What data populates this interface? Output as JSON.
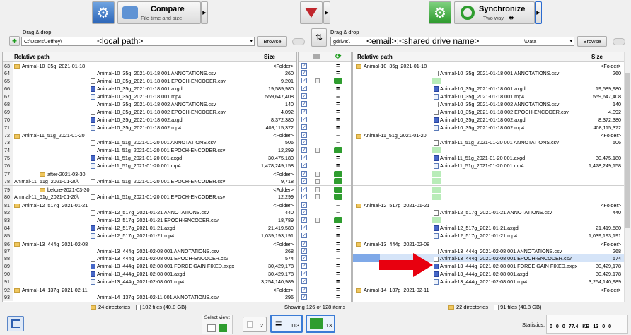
{
  "toolbar": {
    "compare_title": "Compare",
    "compare_sub": "File time and size",
    "sync_title": "Synchronize",
    "sync_sub": "Two way"
  },
  "left_folder": {
    "label": "Drag & drop",
    "path": "C:\\Users\\Jeffrey\\",
    "annotation": "<local path>",
    "browse": "Browse"
  },
  "right_folder": {
    "label": "Drag & drop",
    "path": "gdrive:\\",
    "annotation": "<email>:<shared drive name>",
    "path_suffix": "\\Data",
    "browse": "Browse"
  },
  "columns": {
    "relative_path": "Relative path",
    "size": "Size"
  },
  "rows": [
    {
      "n": "63",
      "lf": "Animal-10_35g_2021-01-18",
      "ln": "",
      "ls": "<Folder>",
      "rf": "Animal-10_35g_2021-01-18",
      "rn": "",
      "rs": "<Folder>",
      "act": "eq",
      "sep": true
    },
    {
      "n": "64",
      "lf": "",
      "ln": "Animal-10_35g_2021-01-18 001 ANNOTATIONS.csv",
      "ls": "260",
      "rf": "",
      "rn": "Animal-10_35g_2021-01-18 001 ANNOTATIONS.csv",
      "rs": "260",
      "act": "eq"
    },
    {
      "n": "65",
      "lf": "",
      "ln": "Animal-10_35g_2021-01-18 001 EPOCH-ENCODER.csv",
      "ls": "9,201",
      "rf": "",
      "rn": "",
      "rs": "",
      "act": "green"
    },
    {
      "n": "66",
      "lf": "",
      "ln": "Animal-10_35g_2021-01-18 001.axgd",
      "ls": "19,589,980",
      "rf": "",
      "rn": "Animal-10_35g_2021-01-18 001.axgd",
      "rs": "19,589,980",
      "act": "eq"
    },
    {
      "n": "67",
      "lf": "",
      "ln": "Animal-10_35g_2021-01-18 001.mp4",
      "ls": "559,647,408",
      "rf": "",
      "rn": "Animal-10_35g_2021-01-18 001.mp4",
      "rs": "559,647,408",
      "act": "eq"
    },
    {
      "n": "68",
      "lf": "",
      "ln": "Animal-10_35g_2021-01-18 002 ANNOTATIONS.csv",
      "ls": "140",
      "rf": "",
      "rn": "Animal-10_35g_2021-01-18 002 ANNOTATIONS.csv",
      "rs": "140",
      "act": "eq"
    },
    {
      "n": "69",
      "lf": "",
      "ln": "Animal-10_35g_2021-01-18 002 EPOCH-ENCODER.csv",
      "ls": "4,092",
      "rf": "",
      "rn": "Animal-10_35g_2021-01-18 002 EPOCH-ENCODER.csv",
      "rs": "4,092",
      "act": "eq"
    },
    {
      "n": "70",
      "lf": "",
      "ln": "Animal-10_35g_2021-01-18 002.axgd",
      "ls": "8,372,380",
      "rf": "",
      "rn": "Animal-10_35g_2021-01-18 002.axgd",
      "rs": "8,372,380",
      "act": "eq"
    },
    {
      "n": "71",
      "lf": "",
      "ln": "Animal-10_35g_2021-01-18 002.mp4",
      "ls": "408,115,372",
      "rf": "",
      "rn": "Animal-10_35g_2021-01-18 002.mp4",
      "rs": "408,115,372",
      "act": "eq"
    },
    {
      "n": "72",
      "lf": "Animal-11_51g_2021-01-20",
      "ln": "",
      "ls": "<Folder>",
      "rf": "Animal-11_51g_2021-01-20",
      "rn": "",
      "rs": "<Folder>",
      "act": "eq",
      "sep": true
    },
    {
      "n": "73",
      "lf": "",
      "ln": "Animal-11_51g_2021-01-20 001 ANNOTATIONS.csv",
      "ls": "506",
      "rf": "",
      "rn": "Animal-11_51g_2021-01-20 001 ANNOTATIONS.csv",
      "rs": "506",
      "act": "eq"
    },
    {
      "n": "74",
      "lf": "",
      "ln": "Animal-11_51g_2021-01-20 001 EPOCH-ENCODER.csv",
      "ls": "12,299",
      "rf": "",
      "rn": "",
      "rs": "",
      "act": "green"
    },
    {
      "n": "75",
      "lf": "",
      "ln": "Animal-11_51g_2021-01-20 001.axgd",
      "ls": "30,475,180",
      "rf": "",
      "rn": "Animal-11_51g_2021-01-20 001.axgd",
      "rs": "30,475,180",
      "act": "eq"
    },
    {
      "n": "76",
      "lf": "",
      "ln": "Animal-11_51g_2021-01-20 001.mp4",
      "ls": "1,478,249,158",
      "rf": "",
      "rn": "Animal-11_51g_2021-01-20 001.mp4",
      "rs": "1,478,249,158",
      "act": "eq"
    },
    {
      "n": "77",
      "lf": "after-2021-03-30",
      "ln": "",
      "ls": "<Folder>",
      "rf": "",
      "rn": "",
      "rs": "",
      "act": "green",
      "sep": true,
      "indent": true
    },
    {
      "n": "78",
      "lf": "Animal-11_51g_2021-01-20\\",
      "ln": "Animal-11_51g_2021-01-20 001 EPOCH-ENCODER.csv",
      "ls": "9,718",
      "rf": "",
      "rn": "",
      "rs": "",
      "act": "green"
    },
    {
      "n": "79",
      "lf": "before-2021-03-30",
      "ln": "",
      "ls": "<Folder>",
      "rf": "",
      "rn": "",
      "rs": "",
      "act": "green",
      "sep": true,
      "indent": true
    },
    {
      "n": "80",
      "lf": "Animal-11_51g_2021-01-20\\",
      "ln": "Animal-11_51g_2021-01-20 001 EPOCH-ENCODER.csv",
      "ls": "12,299",
      "rf": "",
      "rn": "",
      "rs": "",
      "act": "green"
    },
    {
      "n": "81",
      "lf": "Animal-12_517g_2021-01-21",
      "ln": "",
      "ls": "<Folder>",
      "rf": "Animal-12_517g_2021-01-21",
      "rn": "",
      "rs": "<Folder>",
      "act": "eq",
      "sep": true
    },
    {
      "n": "82",
      "lf": "",
      "ln": "Animal-12_517g_2021-01-21 ANNOTATIONS.csv",
      "ls": "440",
      "rf": "",
      "rn": "Animal-12_517g_2021-01-21 ANNOTATIONS.csv",
      "rs": "440",
      "act": "eq"
    },
    {
      "n": "83",
      "lf": "",
      "ln": "Animal-12_517g_2021-01-21 EPOCH-ENCODER.csv",
      "ls": "18,789",
      "rf": "",
      "rn": "",
      "rs": "",
      "act": "green"
    },
    {
      "n": "84",
      "lf": "",
      "ln": "Animal-12_517g_2021-01-21.axgd",
      "ls": "21,419,580",
      "rf": "",
      "rn": "Animal-12_517g_2021-01-21.axgd",
      "rs": "21,419,580",
      "act": "eq"
    },
    {
      "n": "85",
      "lf": "",
      "ln": "Animal-12_517g_2021-01-21.mp4",
      "ls": "1,039,193,191",
      "rf": "",
      "rn": "Animal-12_517g_2021-01-21.mp4",
      "rs": "1,039,193,191",
      "act": "eq"
    },
    {
      "n": "86",
      "lf": "Animal-13_444g_2021-02-08",
      "ln": "",
      "ls": "<Folder>",
      "rf": "Animal-13_444g_2021-02-08",
      "rn": "",
      "rs": "<Folder>",
      "act": "eq",
      "sep": true
    },
    {
      "n": "87",
      "lf": "",
      "ln": "Animal-13_444g_2021-02-08 001 ANNOTATIONS.csv",
      "ls": "268",
      "rf": "",
      "rn": "Animal-13_444g_2021-02-08 001 ANNOTATIONS.csv",
      "rs": "268",
      "act": "eq"
    },
    {
      "n": "88",
      "lf": "",
      "ln": "Animal-13_444g_2021-02-08 001 EPOCH-ENCODER.csv",
      "ls": "574",
      "rf": "",
      "rn": "Animal-13_444g_2021-02-08 001 EPOCH-ENCODER.csv",
      "rs": "574",
      "act": "eq",
      "sel": true
    },
    {
      "n": "89",
      "lf": "",
      "ln": "Animal-13_444g_2021-02-08 001 FORCE GAIN FIXED.axgx",
      "ls": "30,429,178",
      "rf": "",
      "rn": "Animal-13_444g_2021-02-08 001 FORCE GAIN FIXED.axgx",
      "rs": "30,429,178",
      "act": "eq"
    },
    {
      "n": "90",
      "lf": "",
      "ln": "Animal-13_444g_2021-02-08 001.axgd",
      "ls": "30,429,178",
      "rf": "",
      "rn": "Animal-13_444g_2021-02-08 001.axgd",
      "rs": "30,429,178",
      "act": "eq"
    },
    {
      "n": "91",
      "lf": "",
      "ln": "Animal-13_444g_2021-02-08 001.mp4",
      "ls": "3,254,140,989",
      "rf": "",
      "rn": "Animal-13_444g_2021-02-08 001.mp4",
      "rs": "3,254,140,989",
      "act": "eq"
    },
    {
      "n": "92",
      "lf": "Animal-14_137g_2021-02-11",
      "ln": "",
      "ls": "<Folder>",
      "rf": "Animal-14_137g_2021-02-11",
      "rn": "",
      "rs": "<Folder>",
      "act": "eq",
      "sep": true
    },
    {
      "n": "93",
      "lf": "",
      "ln": "Animal-14_137g_2021-02-11 001 ANNOTATIONS.csv",
      "ls": "296",
      "rf": "",
      "rn": "",
      "rs": "",
      "act": "eq"
    }
  ],
  "status": {
    "left_dirs": "24 directories",
    "left_files": "102 files (40.8 GB)",
    "center": "Showing 126 of 128 items",
    "right_dirs": "22 directories",
    "right_files": "91 files (40.8 GB)"
  },
  "bottom": {
    "select_view": "Select view:",
    "count_a": "2",
    "count_eq": "113",
    "count_sync": "13",
    "statistics": "Statistics:",
    "stat_values": [
      "0",
      "0",
      "0",
      "77.4 KB",
      "13",
      "0",
      "0"
    ]
  }
}
